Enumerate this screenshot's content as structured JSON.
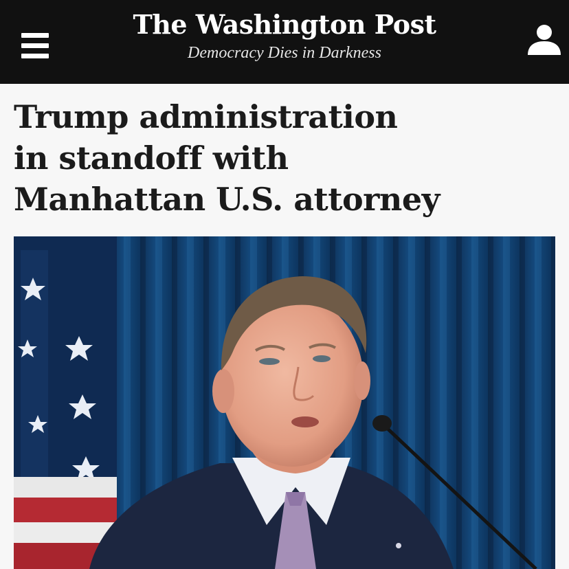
{
  "header": {
    "brand": "The Washington Post",
    "tagline": "Democracy Dies in Darkness",
    "menu_icon": "hamburger-menu-icon",
    "account_icon": "user-account-icon",
    "background_color": "#111111"
  },
  "article": {
    "headline_line1": "Trump administration",
    "headline_line2": "in standoff with",
    "headline_line3": "Manhattan U.S. attorney"
  },
  "colors": {
    "page_background": "#f7f7f7",
    "headline_text": "#1b1b1b"
  }
}
